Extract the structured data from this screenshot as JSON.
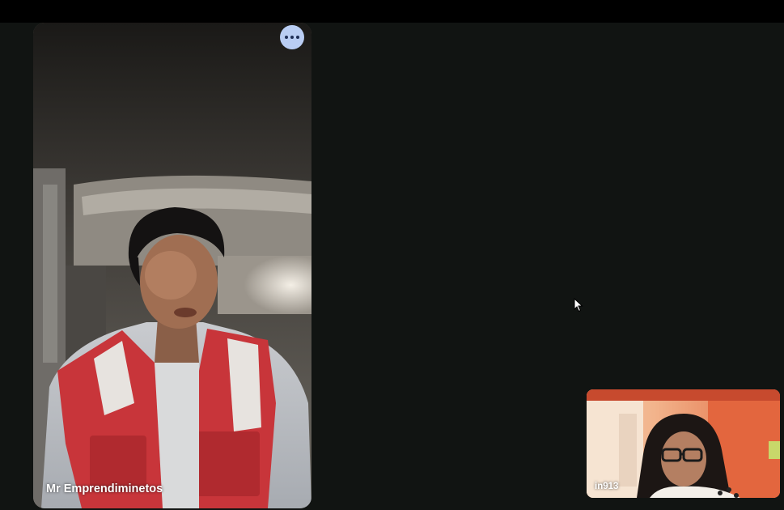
{
  "main_participant": {
    "name": "Mr Emprendiminetos",
    "more_options_icon": "more-horizontal-icon"
  },
  "self_view": {
    "name": "in913"
  },
  "colors": {
    "background": "#111412",
    "top_bar": "#000000",
    "more_button": "#b9cdf3",
    "vest_red": "#c8353a"
  }
}
